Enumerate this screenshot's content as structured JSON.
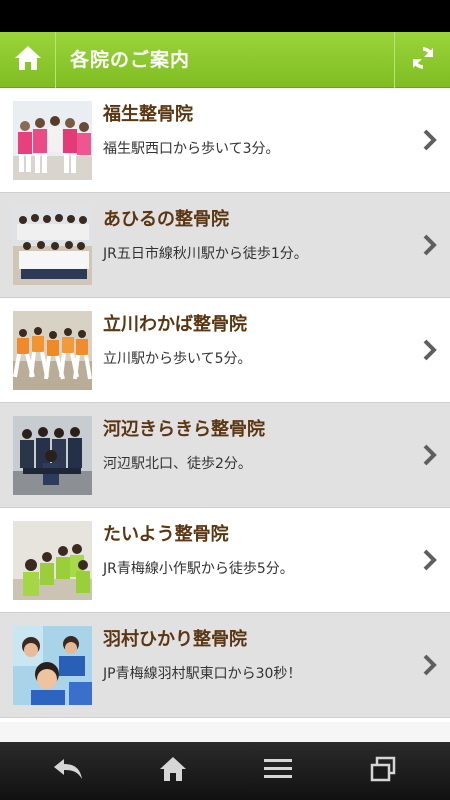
{
  "header": {
    "title": "各院のご案内",
    "home_icon": "home-icon",
    "refresh_icon": "refresh-icon",
    "accent": "#8cc63f"
  },
  "clinics": [
    {
      "name": "福生整骨院",
      "access": "福生駅西口から歩いて3分。"
    },
    {
      "name": "あひるの整骨院",
      "access": "JR五日市線秋川駅から徒歩1分。"
    },
    {
      "name": "立川わかば整骨院",
      "access": "立川駅から歩いて5分。"
    },
    {
      "name": "河辺きらきら整骨院",
      "access": "河辺駅北口、徒歩2分。"
    },
    {
      "name": "たいよう整骨院",
      "access": "JR青梅線小作駅から徒歩5分。"
    },
    {
      "name": "羽村ひかり整骨院",
      "access": "JP青梅線羽村駅東口から30秒！"
    }
  ],
  "nav": {
    "icons": [
      "back-icon",
      "home-icon",
      "menu-icon",
      "recent-apps-icon"
    ]
  },
  "colors": {
    "name_text": "#5a3612",
    "row_alt": "#e1e1e1"
  }
}
